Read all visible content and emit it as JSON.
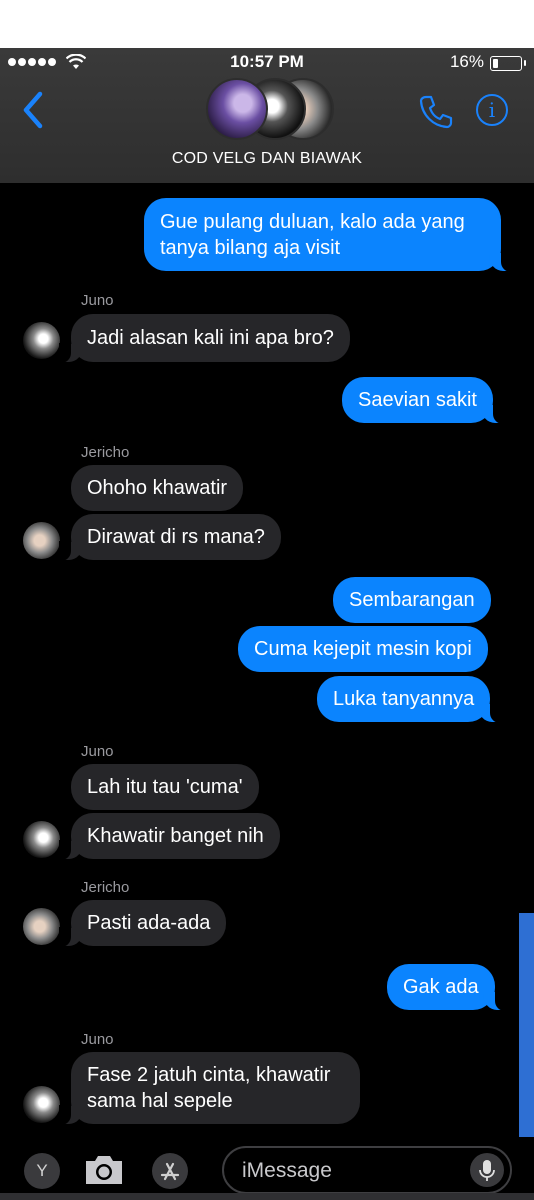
{
  "status": {
    "time": "10:57 PM",
    "battery": "16%",
    "battery_level": 0.16
  },
  "header": {
    "title": "COD VELG DAN BIAWAK",
    "back_icon": "chevron-left-icon",
    "call_icon": "phone-icon",
    "info_icon": "info-icon",
    "info_glyph": "i"
  },
  "colors": {
    "accent": "#0b84fe",
    "incoming": "#262629",
    "background": "#000000"
  },
  "messages": [
    {
      "type": "out",
      "text": "Gue pulang duluan, kalo ada yang tanya bilang aja visit"
    },
    {
      "type": "in",
      "sender": "Juno",
      "text": "Jadi alasan kali ini apa bro?"
    },
    {
      "type": "out",
      "text": "Saevian sakit"
    },
    {
      "type": "in",
      "sender": "Jericho",
      "text": "Ohoho khawatir"
    },
    {
      "type": "in",
      "text": "Dirawat di rs mana?"
    },
    {
      "type": "out",
      "text": "Sembarangan"
    },
    {
      "type": "out",
      "text": "Cuma kejepit mesin kopi"
    },
    {
      "type": "out",
      "text": "Luka tanyannya"
    },
    {
      "type": "in",
      "sender": "Juno",
      "text": "Lah itu tau 'cuma'"
    },
    {
      "type": "in",
      "text": "Khawatir banget nih"
    },
    {
      "type": "in",
      "sender": "Jericho",
      "text": "Pasti ada-ada"
    },
    {
      "type": "out",
      "text": "Gak ada"
    },
    {
      "type": "in",
      "sender": "Juno",
      "text": "Fase 2 jatuh cinta, khawatir sama hal sepele"
    }
  ],
  "input": {
    "placeholder": "iMessage",
    "apps_label": "Y",
    "camera_icon": "camera-icon",
    "store_icon": "app-store-icon",
    "mic_icon": "microphone-icon"
  }
}
